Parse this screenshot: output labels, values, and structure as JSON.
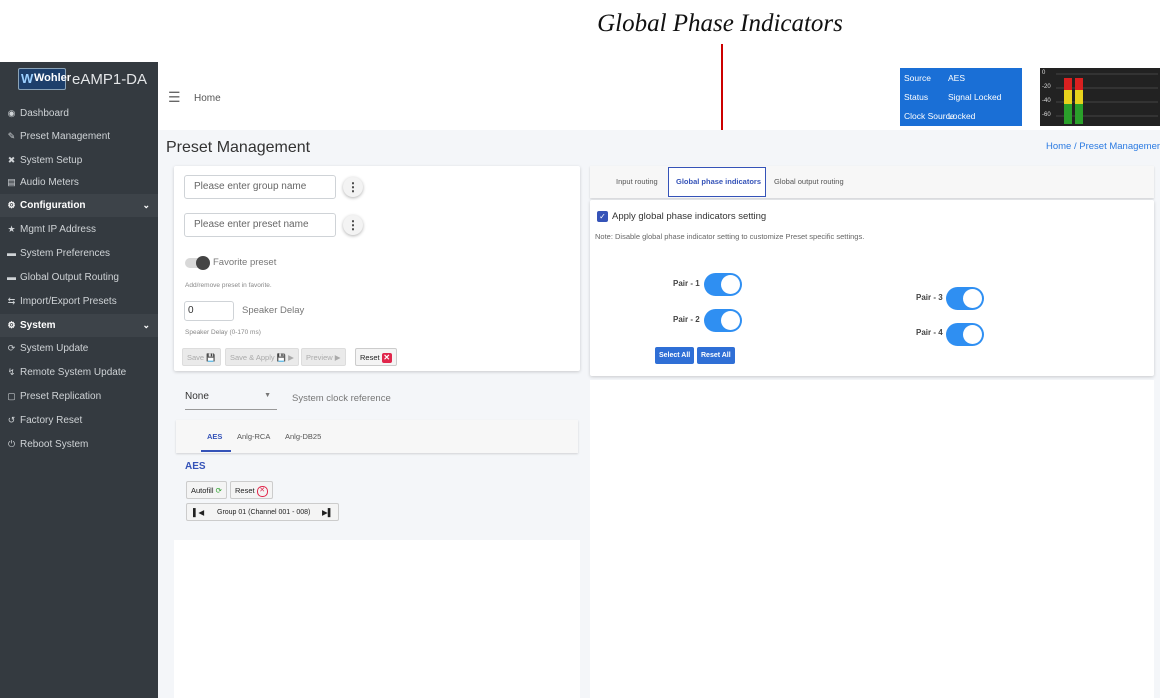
{
  "callout": {
    "title": "Global Phase Indicators"
  },
  "app": {
    "brand": "Wohler",
    "name": "eAMP1-DA"
  },
  "header": {
    "home": "Home"
  },
  "status": {
    "rows": [
      {
        "label": "Source",
        "value": "AES"
      },
      {
        "label": "Status",
        "value": "Signal Locked"
      },
      {
        "label": "Clock Source",
        "value": "Locked"
      }
    ]
  },
  "meter": {
    "scale": [
      "0",
      "-20",
      "-40",
      "-60"
    ]
  },
  "sidebar": {
    "items": [
      {
        "label": "Dashboard",
        "icon": "dashboard-icon"
      },
      {
        "label": "Preset Management",
        "icon": "preset-icon"
      },
      {
        "label": "System Setup",
        "icon": "tools-icon"
      },
      {
        "label": "Audio Meters",
        "icon": "meter-icon"
      },
      {
        "label": "Configuration",
        "icon": "gear-icon"
      },
      {
        "label": "Mgmt IP Address",
        "icon": "network-icon"
      },
      {
        "label": "System Preferences",
        "icon": "prefs-icon"
      },
      {
        "label": "Global Output Routing",
        "icon": "routing-icon"
      },
      {
        "label": "Import/Export Presets",
        "icon": "swap-icon"
      },
      {
        "label": "System",
        "icon": "gears-icon"
      },
      {
        "label": "System Update",
        "icon": "refresh-icon"
      },
      {
        "label": "Remote System Update",
        "icon": "remote-icon"
      },
      {
        "label": "Preset Replication",
        "icon": "copy-icon"
      },
      {
        "label": "Factory Reset",
        "icon": "undo-icon"
      },
      {
        "label": "Reboot System",
        "icon": "power-icon"
      }
    ]
  },
  "page": {
    "title": "Preset Management",
    "breadcrumb": "Home / Preset Managemer"
  },
  "left": {
    "group_placeholder": "Please enter group name",
    "preset_placeholder": "Please enter preset name",
    "favorite_label": "Favorite preset",
    "favorite_hint": "Add/remove preset in favorite.",
    "delay_value": "0",
    "delay_label": "Speaker Delay",
    "delay_hint": "Speaker Delay (0-170 ms)",
    "save": "Save",
    "save_apply": "Save & Apply",
    "preview": "Preview",
    "reset": "Reset",
    "clock_value": "None",
    "clock_label": "System clock reference",
    "tabs": [
      "AES",
      "Anlg-RCA",
      "Anlg-DB25"
    ],
    "section_title": "AES",
    "autofill": "Autofill",
    "reset2": "Reset",
    "group_nav": "Group 01 (Channel 001 - 008)"
  },
  "right": {
    "tabs": [
      "Input routing",
      "Global phase indicators",
      "Global output routing"
    ],
    "apply_label": "Apply global phase indicators setting",
    "note": "Note: Disable global phase indicator setting to customize Preset specific settings.",
    "pairs": [
      "Pair - 1",
      "Pair - 2",
      "Pair - 3",
      "Pair - 4"
    ],
    "select_all": "Select All",
    "reset_all": "Reset All"
  },
  "colors": {
    "sidebar": "#343a40",
    "accent": "#2f8ff2",
    "status_bg": "#1a6fd6",
    "callout": "#cc0000"
  }
}
